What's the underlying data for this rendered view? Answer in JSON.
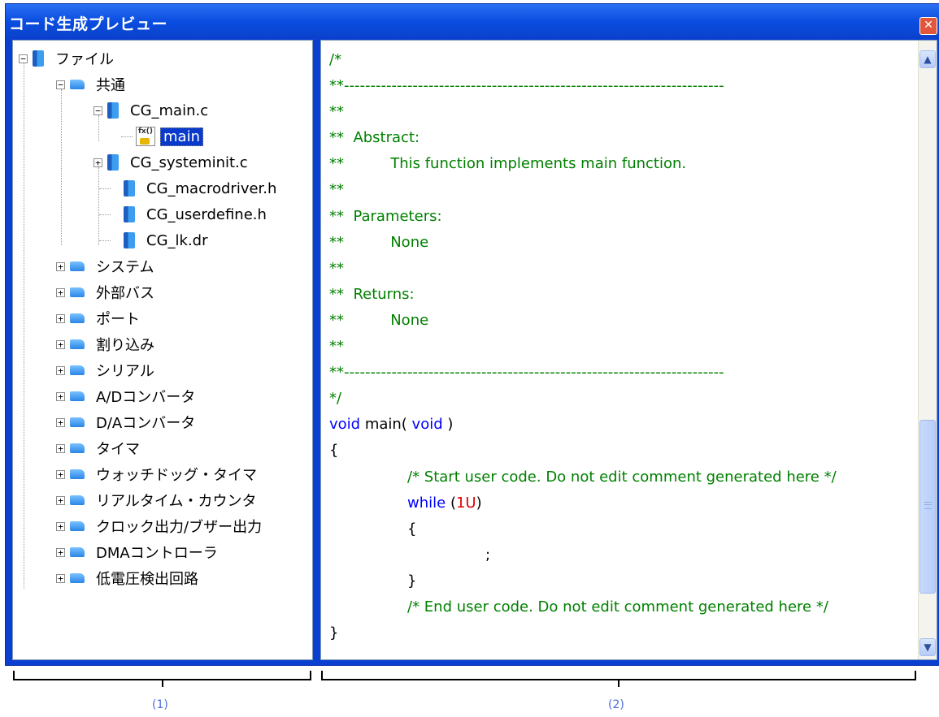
{
  "window": {
    "title": "コード生成プレビュー",
    "close_icon": "close-icon"
  },
  "tree": {
    "root": {
      "label": "ファイル",
      "expander": "−"
    },
    "common": {
      "label": "共通",
      "expander": "−"
    },
    "files": [
      {
        "label": "CG_main.c",
        "expander": "−"
      },
      {
        "label": "CG_systeminit.c",
        "expander": "+"
      },
      {
        "label": "CG_macrodriver.h"
      },
      {
        "label": "CG_userdefine.h"
      },
      {
        "label": "CG_lk.dr"
      }
    ],
    "func": {
      "label": "main",
      "icon_text": "fx()"
    },
    "folders": [
      {
        "label": "システム"
      },
      {
        "label": "外部バス"
      },
      {
        "label": "ポート"
      },
      {
        "label": "割り込み"
      },
      {
        "label": "シリアル"
      },
      {
        "label": "A/Dコンバータ"
      },
      {
        "label": "D/Aコンバータ"
      },
      {
        "label": "タイマ"
      },
      {
        "label": "ウォッチドッグ・タイマ"
      },
      {
        "label": "リアルタイム・カウンタ"
      },
      {
        "label": "クロック出力/ブザー出力"
      },
      {
        "label": "DMAコントローラ"
      },
      {
        "label": "低電圧検出回路"
      }
    ],
    "folder_expander": "+"
  },
  "code": {
    "lines": [
      "/*",
      "**------------------------------------------------------------------------",
      "**",
      "**  Abstract:",
      "**          This function implements main function.",
      "**",
      "**  Parameters:",
      "**          None",
      "**",
      "**  Returns:",
      "**          None",
      "**",
      "**------------------------------------------------------------------------",
      "*/"
    ],
    "func_kw_void": "void",
    "func_name": " main( ",
    "func_kw_void2": "void",
    "func_close": " )",
    "open_brace": "{",
    "start_comment": "/* Start user code. Do not edit comment generated here */",
    "while_kw": "while",
    "while_open": " (",
    "while_num": "1U",
    "while_close": ")",
    "inner_open": "{",
    "semicolon": ";",
    "inner_close": "}",
    "end_comment": "/* End user code. Do not edit comment generated here */",
    "close_brace": "}"
  },
  "scrollbar": {
    "up_icon": "▲",
    "down_icon": "▼"
  },
  "labels": {
    "left": "(1)",
    "right": "(2)"
  }
}
